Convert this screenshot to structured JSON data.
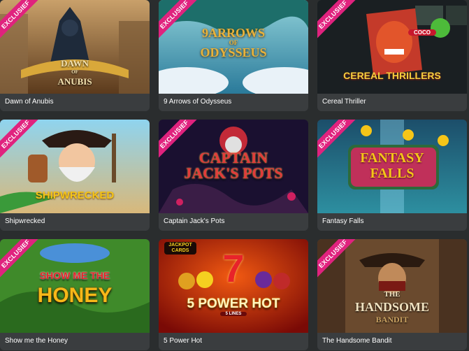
{
  "ribbon_label": "EXCLUSIEF",
  "colors": {
    "background": "#2a2d2e",
    "card": "#3a3d3f",
    "ribbon": "#e0227e"
  },
  "games": [
    {
      "title": "Dawn of Anubis",
      "exclusive": true,
      "logo": [
        "DAWN",
        "OF",
        "ANUBIS"
      ]
    },
    {
      "title": "9 Arrows of Odysseus",
      "exclusive": true,
      "logo": [
        "9ARROWS",
        "OF",
        "ODYSSEUS"
      ]
    },
    {
      "title": "Cereal Thriller",
      "exclusive": true,
      "logo": [
        "COCO",
        "CEREAL THRILLERS"
      ]
    },
    {
      "title": "Shipwrecked",
      "exclusive": true,
      "logo": [
        "SHIPWRECKED"
      ]
    },
    {
      "title": "Captain Jack's Pots",
      "exclusive": true,
      "logo": [
        "CAPTAIN",
        "JACK'S POTS"
      ]
    },
    {
      "title": "Fantasy Falls",
      "exclusive": true,
      "logo": [
        "FANTASY",
        "FALLS"
      ]
    },
    {
      "title": "Show me the Honey",
      "exclusive": true,
      "logo": [
        "SHOW ME THE",
        "HONEY"
      ]
    },
    {
      "title": "5 Power Hot",
      "exclusive": false,
      "logo": [
        "JACKPOT",
        "CARDS",
        "7",
        "5 POWER HOT",
        "5 LINES"
      ]
    },
    {
      "title": "The Handsome Bandit",
      "exclusive": true,
      "logo": [
        "THE",
        "HANDSOME",
        "BANDIT"
      ]
    }
  ]
}
